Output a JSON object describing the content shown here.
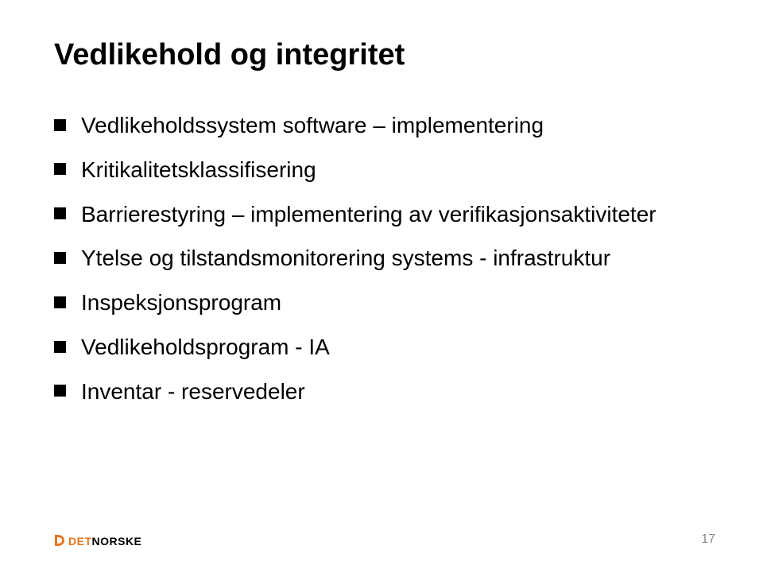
{
  "title": "Vedlikehold og integritet",
  "bullets": {
    "b0": "Vedlikeholdssystem software – implementering",
    "b1": "Kritikalitetsklassifisering",
    "b2": "Barrierestyring – implementering av verifikasjonsaktiviteter",
    "b3": "Ytelse og tilstandsmonitorering systems - infrastruktur",
    "b4": "Inspeksjonsprogram",
    "b5": "Vedlikeholdsprogram - IA",
    "b6": "Inventar - reservedeler"
  },
  "logo": {
    "det": "DET",
    "norske": "NORSKE"
  },
  "page_number": "17"
}
